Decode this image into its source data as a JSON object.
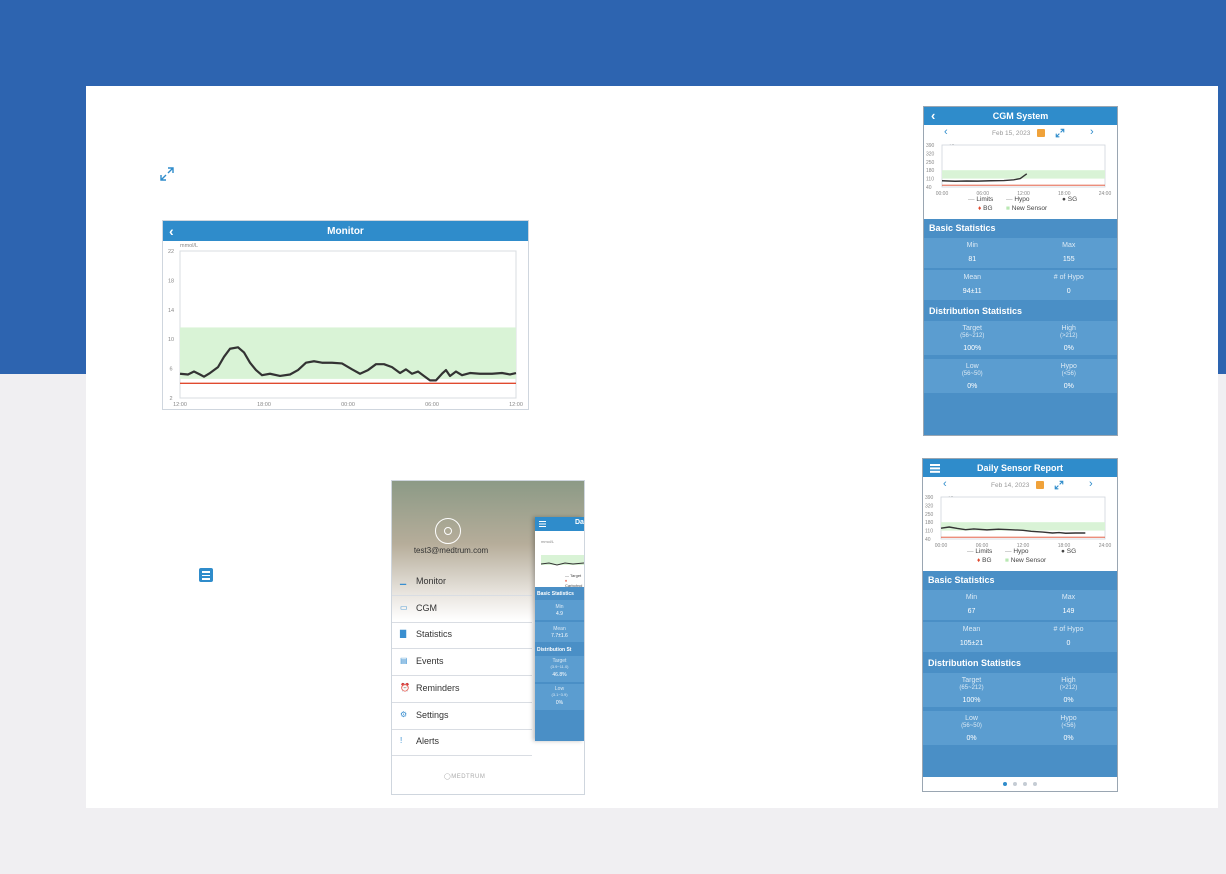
{
  "colors": {
    "brand_blue": "#2d64b0",
    "app_bar": "#2f8ccb",
    "target_band": "#d9f3d6",
    "hypo_line": "#e04a2f",
    "trace": "#333333"
  },
  "icons": {
    "expand": "expand-icon",
    "hamburger": "hamburger-menu-icon"
  },
  "monitor": {
    "title": "Monitor",
    "unit": "mmol/L",
    "y_ticks": [
      "22",
      "18",
      "14",
      "10",
      "6",
      "2"
    ],
    "x_ticks": [
      "12:00",
      "18:00",
      "00:00",
      "06:00",
      "12:00"
    ]
  },
  "menu": {
    "email": "test3@medtrum.com",
    "items": [
      "Monitor",
      "CGM",
      "Statistics",
      "Events",
      "Reminders",
      "Settings",
      "Alerts"
    ],
    "footer": "MEDTRUM",
    "preview": {
      "title": "Da",
      "unit": "mmol/L",
      "legend": [
        "Target",
        "Carbohyd"
      ],
      "basic_statistics": "Basic Statistics",
      "min_label": "Min",
      "min_value": "4.9",
      "mean_label": "Mean",
      "mean_value": "7.7±1.6",
      "distribution_statistics": "Distribution St",
      "target_label": "Target",
      "target_range": "(3.9~11.0)",
      "target_value": "46.8%",
      "low_label": "Low",
      "low_range": "(3.1~3.9)",
      "low_value": "0%"
    }
  },
  "cgm_system": {
    "title": "CGM System",
    "date": "Feb 15, 2023",
    "unit": "mg/dL",
    "y_ticks": [
      "390",
      "320",
      "250",
      "180",
      "110",
      "40"
    ],
    "x_ticks": [
      "00:00",
      "06:00",
      "12:00",
      "18:00",
      "24:00"
    ],
    "legend": {
      "limits": "Limits",
      "hypo": "Hypo",
      "sg": "SG",
      "bg": "BG",
      "new_sensor": "New Sensor"
    },
    "basic_statistics": "Basic Statistics",
    "min_label": "Min",
    "min_value": "81",
    "max_label": "Max",
    "max_value": "155",
    "mean_label": "Mean",
    "mean_value": "94±11",
    "hypo_label": "# of Hypo",
    "hypo_value": "0",
    "distribution_statistics": "Distribution Statistics",
    "target_label": "Target",
    "target_range": "(56~212)",
    "target_value": "100%",
    "high_label": "High",
    "high_range": "(>212)",
    "high_value": "0%",
    "low_label": "Low",
    "low_range": "(56~50)",
    "low_value": "0%",
    "hypo2_label": "Hypo",
    "hypo2_range": "(<56)",
    "hypo2_value": "0%"
  },
  "daily_report": {
    "title": "Daily Sensor Report",
    "date": "Feb 14, 2023",
    "unit": "mg/dL",
    "y_ticks": [
      "390",
      "320",
      "250",
      "180",
      "110",
      "40"
    ],
    "x_ticks": [
      "00:00",
      "06:00",
      "12:00",
      "18:00",
      "24:00"
    ],
    "legend": {
      "limits": "Limits",
      "hypo": "Hypo",
      "sg": "SG",
      "bg": "BG",
      "new_sensor": "New Sensor"
    },
    "basic_statistics": "Basic Statistics",
    "min_label": "Min",
    "min_value": "67",
    "max_label": "Max",
    "max_value": "149",
    "mean_label": "Mean",
    "mean_value": "105±21",
    "hypo_label": "# of Hypo",
    "hypo_value": "0",
    "distribution_statistics": "Distribution Statistics",
    "target_label": "Target",
    "target_range": "(65~212)",
    "target_value": "100%",
    "high_label": "High",
    "high_range": "(>212)",
    "high_value": "0%",
    "low_label": "Low",
    "low_range": "(56~50)",
    "low_value": "0%",
    "hypo2_label": "Hypo",
    "hypo2_range": "(<56)",
    "hypo2_value": "0%",
    "page_dots": 4,
    "active_dot": 1
  }
}
